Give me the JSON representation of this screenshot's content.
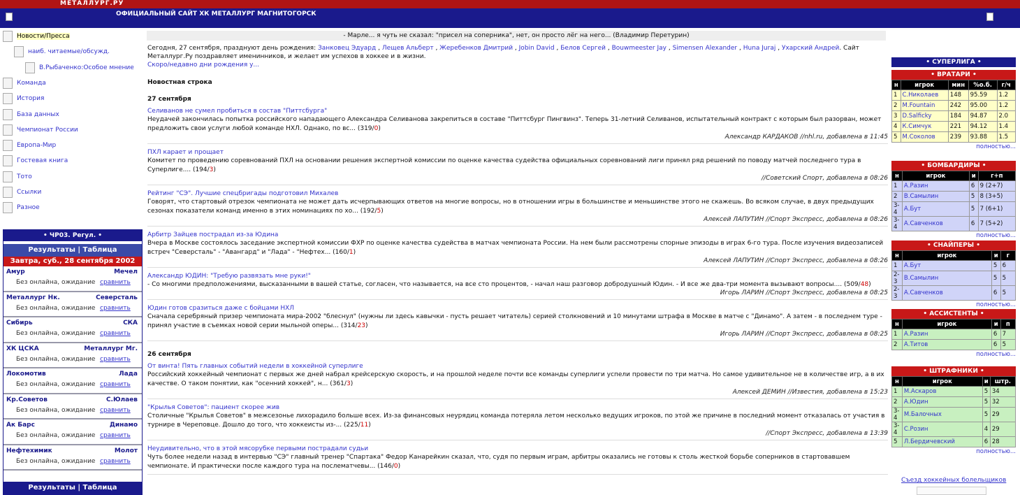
{
  "site": {
    "logo": "МЕТАЛЛУРГ.РУ",
    "title": "ОФИЦИАЛЬНЫЙ САЙТ ХК МЕТАЛЛУРГ МАГНИТОГОРСК"
  },
  "nav": [
    {
      "label": "Новости/Пресса",
      "indent": 0,
      "active": true
    },
    {
      "label": "наиб. читаемые/обсужд.",
      "indent": 1
    },
    {
      "label": "В.Рыбаченко:Особое мнение",
      "indent": 2
    },
    {
      "label": "Команда",
      "indent": 0
    },
    {
      "label": "История",
      "indent": 0
    },
    {
      "label": "База данных",
      "indent": 0
    },
    {
      "label": "Чемпионат России",
      "indent": 0
    },
    {
      "label": "Европа-Мир",
      "indent": 0
    },
    {
      "label": "Гостевая книга",
      "indent": 0
    },
    {
      "label": "Тото",
      "indent": 0
    },
    {
      "label": "Ссылки",
      "indent": 0
    },
    {
      "label": "Разное",
      "indent": 0
    }
  ],
  "champ": {
    "title": "• ЧР03. Регул. •",
    "tabs": "Результаты | Таблица",
    "date": "Завтра, суб., 28 сентября 2002",
    "status": "Без онлайна, ожидание",
    "compare": "сравнить",
    "matches": [
      {
        "t1": "Амур",
        "t2": "Мечел"
      },
      {
        "t1": "Металлург Нк.",
        "t2": "Северсталь"
      },
      {
        "t1": "Сибирь",
        "t2": "СКА"
      },
      {
        "t1": "ХК ЦСКА",
        "t2": "Металлург Мг."
      },
      {
        "t1": "Локомотив",
        "t2": "Лада"
      },
      {
        "t1": "Кр.Советов",
        "t2": "С.Юлаев"
      },
      {
        "t1": "Ак Барс",
        "t2": "Динамо"
      },
      {
        "t1": "Нефтехимик",
        "t2": "Молот"
      }
    ]
  },
  "quote": "- Марле... я чуть не сказал: \"присел на соперника\", нет, он просто лёг на него... (Владимир Перетурин)",
  "bday": {
    "prefix": "Сегодня, 27 сентября, празднуют день рождения:",
    "names": [
      "Занковец Эдуард",
      "Лещев Альберт",
      "Жеребенков Дмитрий",
      "Jobin David",
      "Белов Сергей",
      "Bouwmeester Jay",
      "Simensen Alexander",
      "Huna Juraj",
      "Ухарский Андрей"
    ],
    "suffix": ". Сайт Металлург.Ру поздравляет именинников, и желает им успехов в хоккее и в жизни.",
    "link": "Скоро/недавно дни рождения у..."
  },
  "news_header": "Новостная строка",
  "days": [
    {
      "date": "27 сентября",
      "items": [
        {
          "title": "Селиванов не сумел пробиться в состав \"Питтсбурга\"",
          "body": "Неудачей закончилась попытка российского нападающего Александра Селиванова закрепиться в составе \"Питтсбург Пингвинз\". Теперь 31-летний Селиванов, испытательный контракт с которым был разорван, может предложить свои услуги любой команде НХЛ. Однако, по вс...",
          "c1": "(319/",
          "c2": "0",
          "c3": ")",
          "author": "Александр КАРДАКОВ //nhl.ru, добавлена в 11:45"
        },
        {
          "title": "ПХЛ карает и прощает",
          "body": "Комитет по проведению соревнований ПХЛ на основании решения экспертной комиссии по оценке качества судейства официальных соревнований лиги принял ряд решений по поводу матчей последнего тура в Суперлиге....",
          "c1": "(194/",
          "c2": "3",
          "c3": ")",
          "author": "//Советский Спорт, добавлена в 08:26"
        },
        {
          "title": "Рейтинг \"СЭ\". Лучшие спецбригады подготовил Михалев",
          "body": "Говорят, что стартовый отрезок чемпионата не может дать исчерпывающих ответов на многие вопросы, но в отношении игры в большинстве и меньшинстве этого не скажешь. Во всяком случае, в двух предыдущих сезонах показатели команд именно в этих номинациях по хо...",
          "c1": "(192/",
          "c2": "5",
          "c3": ")",
          "author": "Алексей ЛАПУТИН //Спорт Экспресс, добавлена в 08:26"
        },
        {
          "title": "Арбитр Зайцев пострадал из-за Юдина",
          "body": "Вчера в Москве состоялось заседание экспертной комиссии ФХР по оценке качества судейства в матчах чемпионата России. На нем были рассмотрены спорные эпизоды в играх 6-го тура. После изучения видеозаписей встреч \"Северсталь\" - \"Авангард\" и \"Лада\" - \"Нефтех...",
          "c1": "(160/",
          "c2": "1",
          "c3": ")",
          "author": "Алексей ЛАПУТИН //Спорт Экспресс, добавлена в 08:26"
        },
        {
          "title": "Александр ЮДИН: \"Требую развязать мне руки!\"",
          "body": "- Со многими предположениями, высказанными в вашей статье, согласен, что называется, на все сто процентов, - начал наш разговор добродушный Юдин. - И все же два-три момента вызывают вопросы....",
          "c1": "(509/",
          "c2": "48",
          "c3": ")",
          "author": "Игорь ЛАРИН //Спорт Экспресс, добавлена в 08:25"
        },
        {
          "title": "Юдин готов сразиться даже с бойцами НХЛ",
          "body": "Сначала серебряный призер чемпионата мира-2002 \"блеснул\" (нужны ли здесь кавычки - пусть решает читатель) серией столкновений и 10 минутами штрафа в Москве в матче с \"Динамо\". А затем - в последнем туре - принял участие в съемках новой серии мыльной оперы...",
          "c1": "(314/",
          "c2": "23",
          "c3": ")",
          "author": "Игорь ЛАРИН //Спорт Экспресс, добавлена в 08:25"
        }
      ]
    },
    {
      "date": "26 сентября",
      "items": [
        {
          "title": "От винта! Пять главных событий недели в хоккейной суперлиге",
          "body": "Российский хоккейный чемпионат с первых же дней набрал крейсерскую скорость, и на прошлой неделе почти все команды суперлиги успели провести по три матча. Но самое удивительное не в количестве игр, а в их качестве. О таком понятии, как \"осенний хоккей\", н...",
          "c1": "(361/",
          "c2": "3",
          "c3": ")",
          "author": "Алексей ДЕМИН //Известия, добавлена в 15:23"
        },
        {
          "title": "\"Крылья Советов\": пациент скорее жив",
          "body": "Столичные \"Крылья Советов\" в межсезонье лихорадило больше всех. Из-за финансовых неурядиц команда потеряла летом несколько ведущих игроков, по этой же причине в последний момент отказалась от участия в турнире в Череповце. Дошло до того, что хоккеисты из-...",
          "c1": "(225/",
          "c2": "11",
          "c3": ")",
          "author": "//Спорт Экспресс, добавлена в 13:39"
        },
        {
          "title": "Неудивительно, что в этой мясорубке первыми пострадали судьи",
          "body": "Чуть более недели назад в интервью \"СЭ\" главный тренер \"Спартака\" Федор Канарейкин сказал, что, судя по первым играм, арбитры оказались не готовы к столь жесткой борьбе соперников в стартовавшем чемпионате. И практически после каждого тура на послематчевы...",
          "c1": "(146/",
          "c2": "0",
          "c3": ")",
          "author": ""
        }
      ]
    }
  ],
  "right": {
    "league": "• СУПЕРЛИГА •",
    "more": "полностью...",
    "goalies": {
      "title": "• ВРАТАРИ •",
      "cols": [
        "н",
        "игрок",
        "мин",
        "%о.б.",
        "г/ч"
      ],
      "rows": [
        [
          "1",
          "С.Николаев",
          "148",
          "95.59",
          "1.2"
        ],
        [
          "2",
          "M.Fountain",
          "242",
          "95.00",
          "1.2"
        ],
        [
          "3",
          "D.Salficky",
          "184",
          "94.87",
          "2.0"
        ],
        [
          "4",
          "К.Симчук",
          "221",
          "94.12",
          "1.4"
        ],
        [
          "5",
          "М.Соколов",
          "239",
          "93.88",
          "1.5"
        ]
      ]
    },
    "scorers": {
      "title": "• БОМБАРДИРЫ •",
      "cols": [
        "н",
        "игрок",
        "и",
        "г+п"
      ],
      "rows": [
        [
          "1",
          "А.Разин",
          "6",
          "9 (2+7)"
        ],
        [
          "2",
          "В.Самылин",
          "5",
          "8 (3+5)"
        ],
        [
          "3-4",
          "А.Бут",
          "5",
          "7 (6+1)"
        ],
        [
          "3-4",
          "А.Савченков",
          "6",
          "7 (5+2)"
        ]
      ]
    },
    "snipers": {
      "title": "• СНАЙПЕРЫ •",
      "cols": [
        "н",
        "игрок",
        "и",
        "г"
      ],
      "rows": [
        [
          "1",
          "А.Бут",
          "5",
          "6"
        ],
        [
          "2-3",
          "В.Самылин",
          "5",
          "5"
        ],
        [
          "2-3",
          "А.Савченков",
          "6",
          "5"
        ]
      ]
    },
    "assists": {
      "title": "• АССИСТЕНТЫ •",
      "cols": [
        "н",
        "игрок",
        "и",
        "п"
      ],
      "rows": [
        [
          "1",
          "А.Разин",
          "6",
          "7"
        ],
        [
          "2",
          "А.Титов",
          "6",
          "5"
        ]
      ]
    },
    "penalty": {
      "title": "• ШТРАФНИКИ •",
      "cols": [
        "н",
        "игрок",
        "и",
        "штр."
      ],
      "rows": [
        [
          "1",
          "М.Аскаров",
          "5",
          "34"
        ],
        [
          "2",
          "А.Юдин",
          "5",
          "32"
        ],
        [
          "3-4",
          "М.Балочных",
          "5",
          "29"
        ],
        [
          "3-4",
          "С.Розин",
          "4",
          "29"
        ],
        [
          "5",
          "Л.Бердичевский",
          "6",
          "28"
        ]
      ]
    },
    "footer_link": "Съезд хоккейных болельщиков"
  }
}
